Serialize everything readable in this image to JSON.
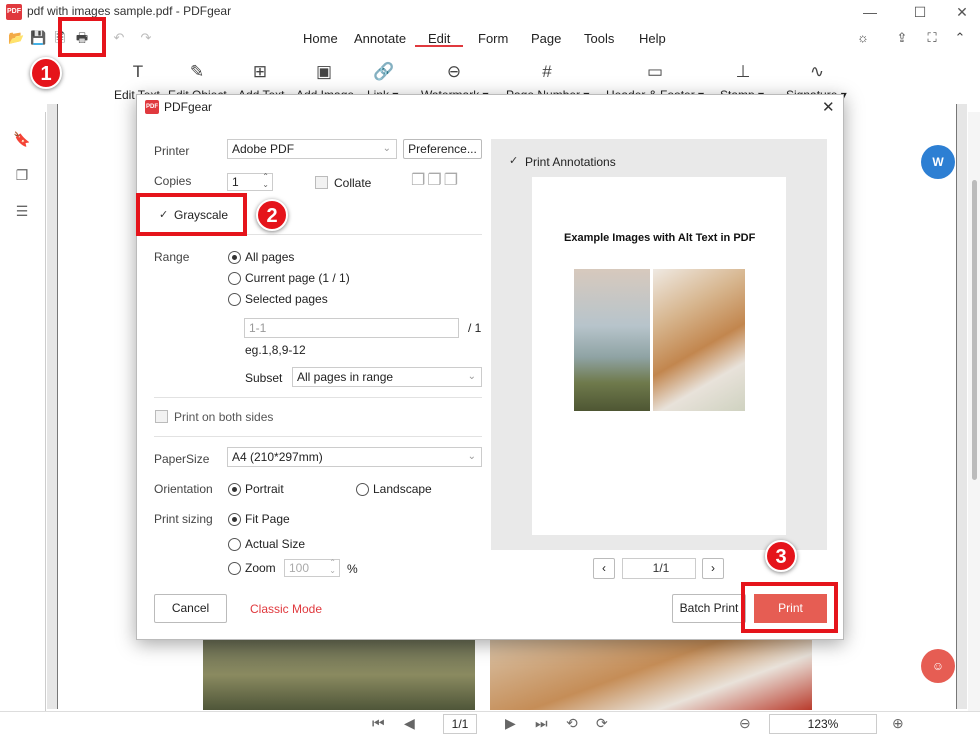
{
  "window": {
    "title": "pdf with images sample.pdf - PDFgear",
    "logo_text": "PDF",
    "controls": [
      "—",
      "☐",
      "✕"
    ]
  },
  "menu": {
    "items": [
      "Home",
      "Annotate",
      "Edit",
      "Form",
      "Page",
      "Tools",
      "Help"
    ],
    "active": "Edit"
  },
  "ribbon": {
    "items": [
      "Edit Text",
      "Edit Object",
      "Add Text",
      "Add Image",
      "Link ▾",
      "Watermark ▾",
      "Page Number ▾",
      "Header & Footer ▾",
      "Stamp ▾",
      "Signature ▾"
    ]
  },
  "dialog": {
    "title": "PDFgear",
    "printer_label": "Printer",
    "printer_value": "Adobe PDF",
    "preference_label": "Preference...",
    "copies_label": "Copies",
    "copies_value": "1",
    "collate_label": "Collate",
    "grayscale_label": "Grayscale",
    "range_label": "Range",
    "range_options": [
      "All pages",
      "Current page (1 / 1)",
      "Selected pages"
    ],
    "range_selected": "All pages",
    "pages_placeholder": "1-1",
    "pages_total": "/ 1",
    "pages_hint": "eg.1,8,9-12",
    "subset_label": "Subset",
    "subset_value": "All pages in range",
    "both_sides_label": "Print on both sides",
    "papersize_label": "PaperSize",
    "papersize_value": "A4 (210*297mm)",
    "orientation_label": "Orientation",
    "orientation_options": [
      "Portrait",
      "Landscape"
    ],
    "orientation_selected": "Portrait",
    "sizing_label": "Print sizing",
    "sizing_options": [
      "Fit Page",
      "Actual Size",
      "Zoom"
    ],
    "sizing_selected": "Fit Page",
    "zoom_value": "100",
    "zoom_unit": "%",
    "cancel_label": "Cancel",
    "classic_mode_label": "Classic Mode",
    "batch_print_label": "Batch Print",
    "print_label": "Print",
    "print_annotations_label": "Print Annotations",
    "preview_title": "Example Images with Alt Text in PDF",
    "preview_page": "1/1"
  },
  "bottom": {
    "page": "1/1",
    "zoom": "123%"
  },
  "annotations": {
    "badges": [
      "1",
      "2",
      "3"
    ]
  },
  "colors": {
    "accent": "#e0393e",
    "highlight": "#e5141b",
    "print_button": "#e65d53",
    "float_blue": "#2d7fd3"
  }
}
